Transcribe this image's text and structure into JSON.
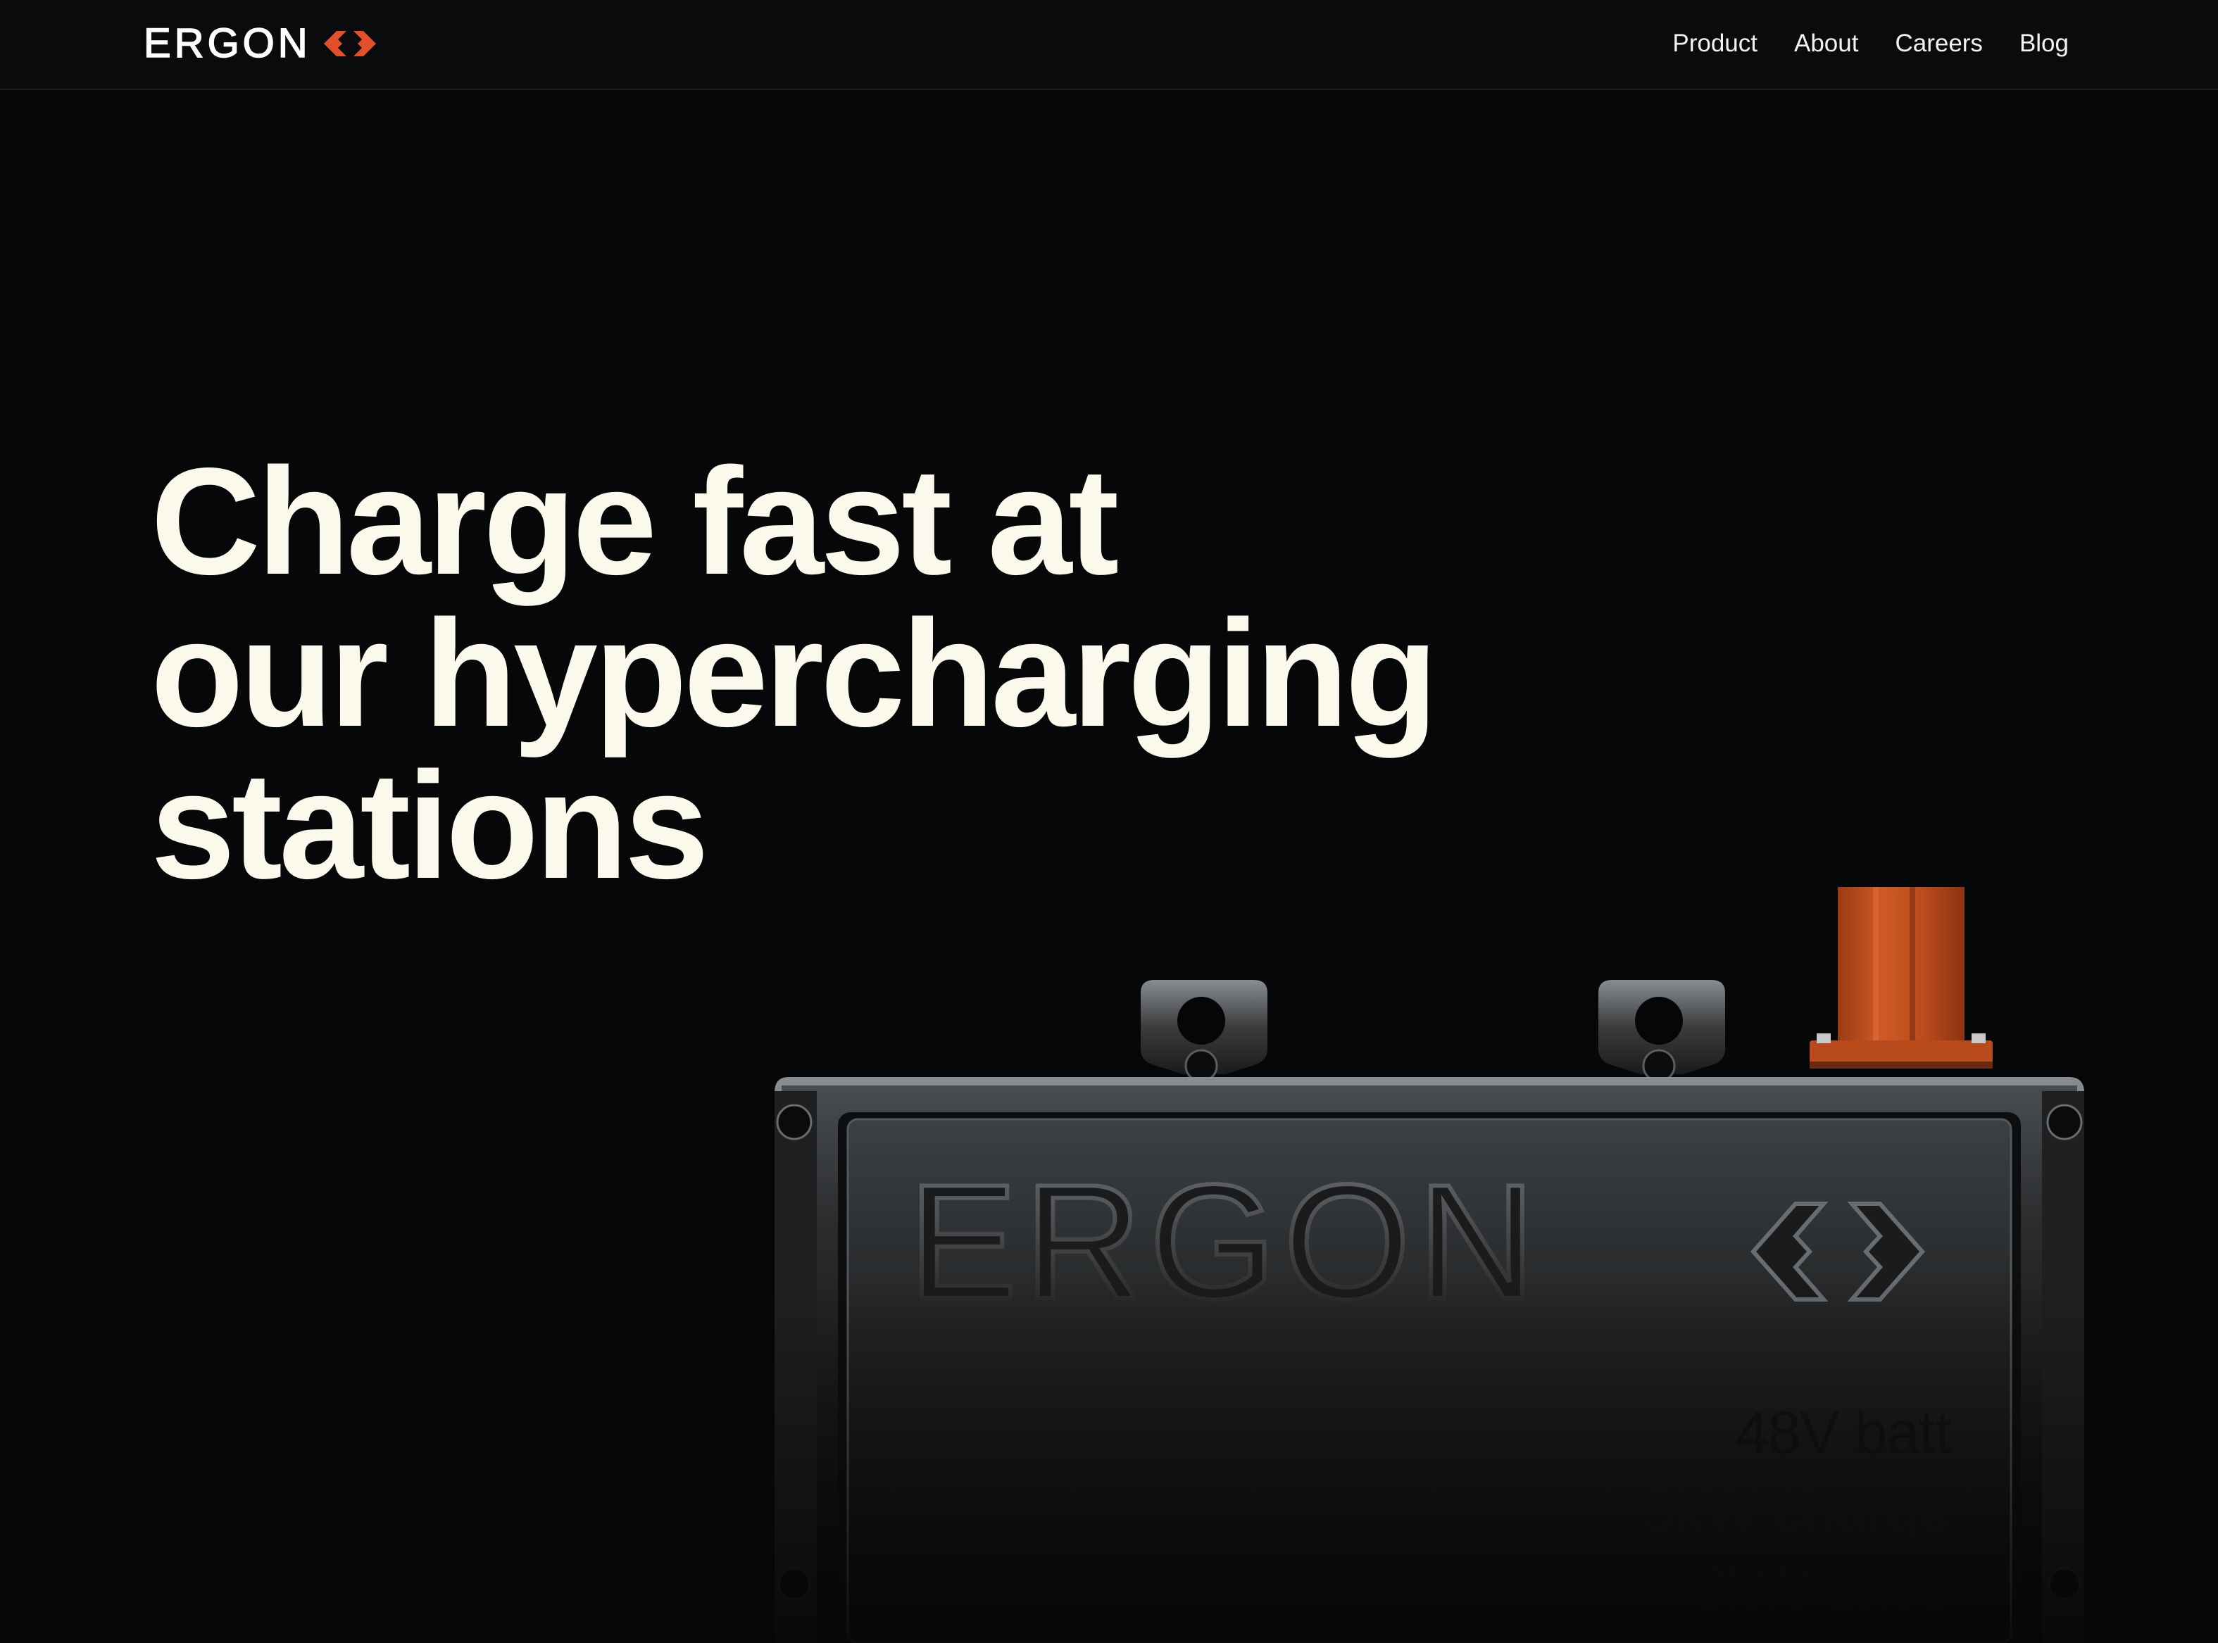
{
  "brand": {
    "name": "ERGON",
    "accent_color": "#e2502a"
  },
  "nav": {
    "items": [
      {
        "label": "Product"
      },
      {
        "label": "About"
      },
      {
        "label": "Careers"
      },
      {
        "label": "Blog"
      }
    ]
  },
  "hero": {
    "title_lines": [
      "Charge fast at",
      "our hypercharging",
      "stations"
    ]
  },
  "product": {
    "emboss_text": "ERGON",
    "specs": [
      "48V batt",
      "3kW charge",
      "8kW drive"
    ],
    "connector_color": "#c4501f"
  },
  "colors": {
    "background": "#050709",
    "header": "#0a0b0c",
    "title_text": "#fbf8ec"
  }
}
